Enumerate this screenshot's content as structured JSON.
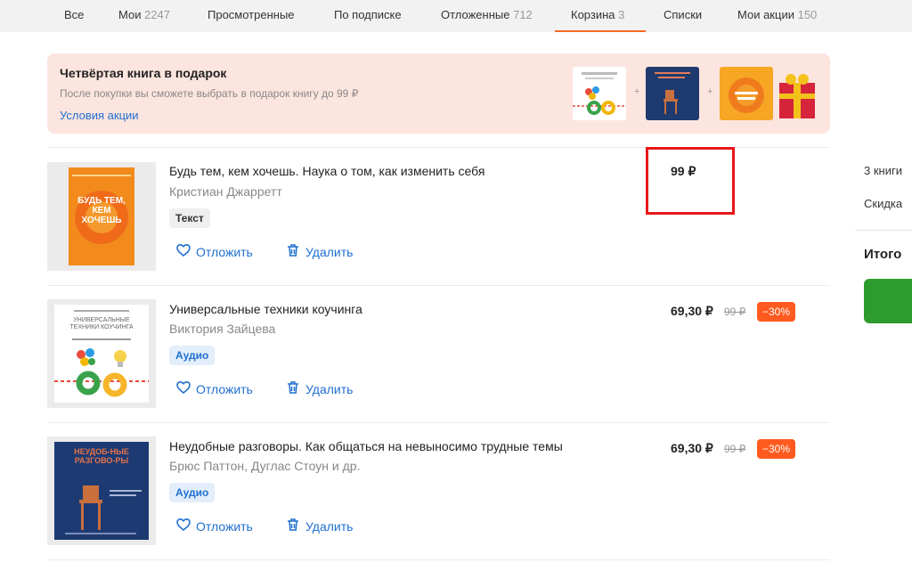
{
  "tabs": [
    {
      "label": "Все",
      "count": ""
    },
    {
      "label": "Мои",
      "count": "2247"
    },
    {
      "label": "Просмотренные",
      "count": ""
    },
    {
      "label": "По подписке",
      "count": ""
    },
    {
      "label": "Отложенные",
      "count": "712"
    },
    {
      "label": "Корзина",
      "count": "3",
      "active": true
    },
    {
      "label": "Списки",
      "count": ""
    },
    {
      "label": "Мои акции",
      "count": "150"
    }
  ],
  "promo": {
    "title": "Четвёртая книга в подарок",
    "subtitle": "После покупки вы сможете выбрать в подарок книгу до 99 ₽",
    "link": "Условия акции",
    "operators": [
      "+",
      "+",
      "="
    ]
  },
  "items": [
    {
      "title": "Будь тем, кем хочешь. Наука о том, как изменить себя",
      "author": "Кристиан Джарретт",
      "format": "Текст",
      "price": "99 ₽",
      "old_price": "",
      "discount": "",
      "cover": "orange-book",
      "cover_text": "БУДЬ ТЕМ, КЕМ ХОЧЕШЬ"
    },
    {
      "title": "Универсальные техники коучинга",
      "author": "Виктория Зайцева",
      "format": "Аудио",
      "price": "69,30 ₽",
      "old_price": "99 ₽",
      "discount": "−30%",
      "cover": "white-book",
      "cover_text": "УНИВЕРСАЛЬНЫЕ ТЕХНИКИ КОУЧИНГА"
    },
    {
      "title": "Неудобные разговоры. Как общаться на невыносимо трудные темы",
      "author": "Брюс Паттон, Дуглас Стоун и др.",
      "format": "Аудио",
      "price": "69,30 ₽",
      "old_price": "99 ₽",
      "discount": "−30%",
      "cover": "blue-book",
      "cover_text": "НЕУДОБ-НЫЕ РАЗГОВО-РЫ"
    }
  ],
  "actions": {
    "defer": "Отложить",
    "delete": "Удалить"
  },
  "summary": {
    "count_label": "3 книги",
    "discount_label": "Скидка",
    "total_label": "Итого"
  },
  "colors": {
    "accent": "#f26b21",
    "link": "#1f6fd0",
    "discount": "#ff5a1f",
    "buy": "#2e9b2e",
    "highlight": "#e81818"
  },
  "icons": {
    "defer": "heart-icon",
    "delete": "trash-icon"
  }
}
